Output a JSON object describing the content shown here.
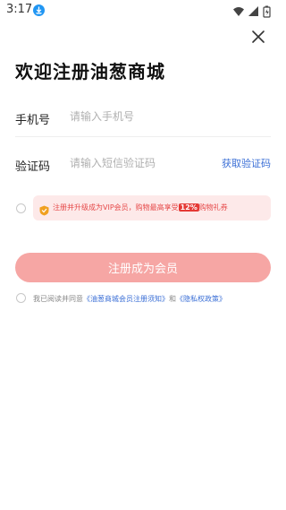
{
  "status_bar": {
    "time": "3:17"
  },
  "page": {
    "title": "欢迎注册油葱商城"
  },
  "phone_field": {
    "label": "手机号",
    "placeholder": "请输入手机号"
  },
  "code_field": {
    "label": "验证码",
    "placeholder": "请输入短信验证码",
    "get_code": "获取验证码"
  },
  "vip_banner": {
    "text_before": "注册并升级成为VIP会员，购物最高享受",
    "percent": "12%",
    "text_after": "购物礼券"
  },
  "register_button": {
    "label": "注册成为会员"
  },
  "agreement": {
    "prefix": "我已阅读并同意",
    "terms_link": "《油葱商城会员注册须知》",
    "and": "和",
    "privacy_link": "《隐私权政策》"
  },
  "colors": {
    "accent": "#f6a6a4",
    "link": "#3b6fd6",
    "banner_bg": "#fde9e9",
    "banner_text": "#e64a4a"
  }
}
